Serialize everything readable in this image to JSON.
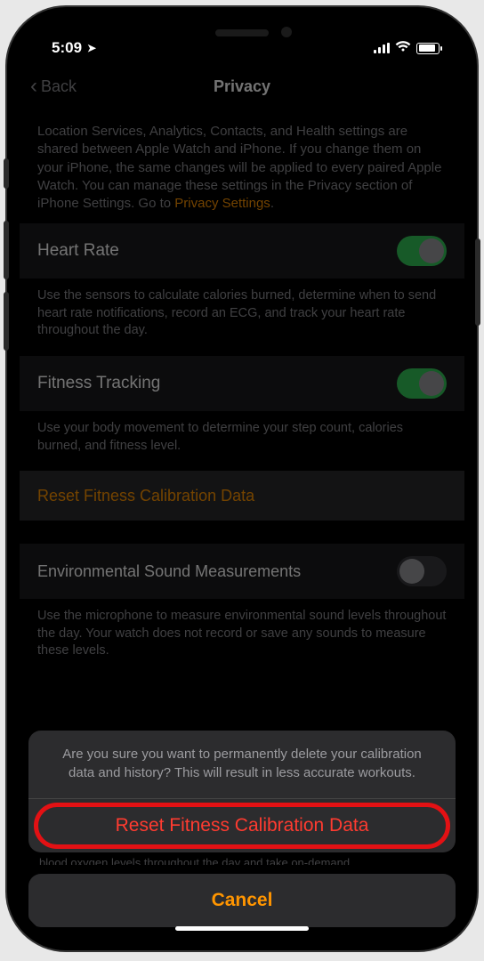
{
  "status": {
    "time": "5:09",
    "loc_arrow": "➤"
  },
  "nav": {
    "back": "Back",
    "title": "Privacy"
  },
  "intro": {
    "text": "Location Services, Analytics, Contacts, and Health settings are shared between Apple Watch and iPhone. If you change them on your iPhone, the same changes will be applied to every paired Apple Watch. You can manage these settings in the Privacy section of iPhone Settings. Go to ",
    "link": "Privacy Settings"
  },
  "rows": {
    "heart": {
      "label": "Heart Rate",
      "desc": "Use the sensors to calculate calories burned, determine when to send heart rate notifications, record an ECG, and track your heart rate throughout the day."
    },
    "fitness": {
      "label": "Fitness Tracking",
      "desc": "Use your body movement to determine your step count, calories burned, and fitness level."
    },
    "reset": {
      "label": "Reset Fitness Calibration Data"
    },
    "env": {
      "label": "Environmental Sound Measurements",
      "desc": "Use the microphone to measure environmental sound levels throughout the day. Your watch does not record or save any sounds to measure these levels."
    },
    "clipped": "blood oxygen levels throughout the day and take on-demand"
  },
  "sheet": {
    "message": "Are you sure you want to permanently delete your calibration data and history? This will result in less accurate workouts.",
    "action": "Reset Fitness Calibration Data",
    "cancel": "Cancel"
  }
}
